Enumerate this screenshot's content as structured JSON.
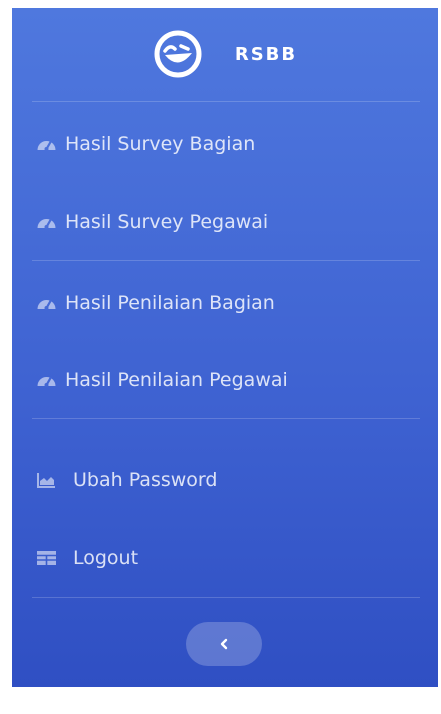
{
  "brand": {
    "icon": "laughing-face-icon",
    "title": "RSBB"
  },
  "nav": {
    "items": [
      {
        "label": "Hasil Survey Bagian",
        "icon": "tachometer-icon"
      },
      {
        "label": "Hasil Survey Pegawai",
        "icon": "tachometer-icon"
      },
      {
        "label": "Hasil Penilaian Bagian",
        "icon": "tachometer-icon"
      },
      {
        "label": "Hasil Penilaian Pegawai",
        "icon": "tachometer-icon"
      }
    ],
    "account": [
      {
        "label": "Ubah Password",
        "icon": "area-chart-icon"
      },
      {
        "label": "Logout",
        "icon": "table-icon"
      }
    ]
  },
  "toggle": {
    "icon": "chevron-left-icon"
  },
  "colors": {
    "sidebar_top": "#4f78de",
    "sidebar_bottom": "#2f4fc3",
    "text": "#ffffff"
  }
}
